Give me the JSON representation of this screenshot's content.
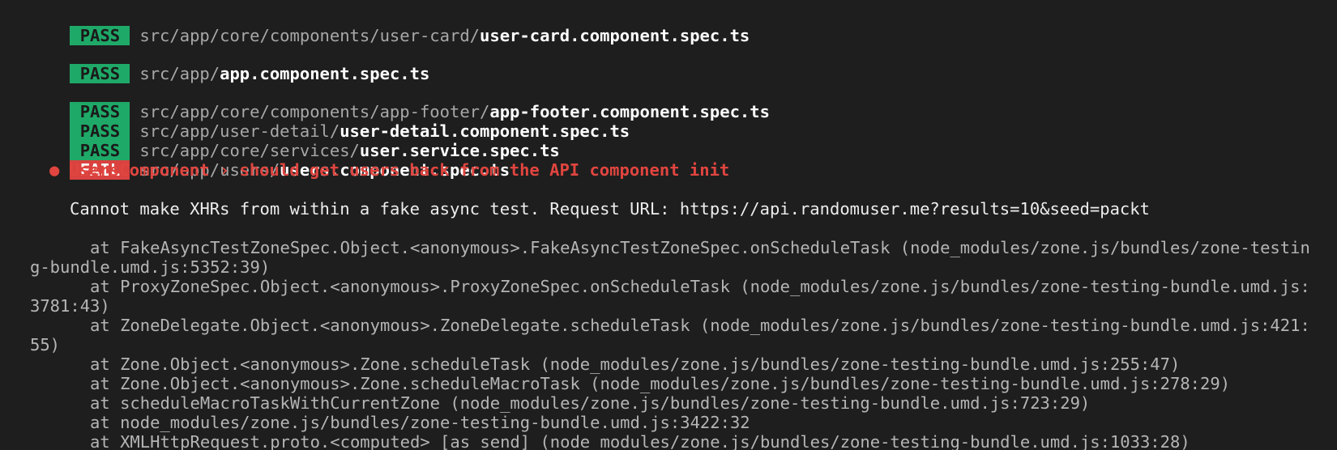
{
  "results": [
    {
      "status": "PASS",
      "dir": "src/app/core/components/user-card/",
      "file": "user-card.component.spec.ts"
    },
    {
      "status": "PASS",
      "dir": "src/app/",
      "file": "app.component.spec.ts"
    },
    {
      "status": "PASS",
      "dir": "src/app/core/components/app-footer/",
      "file": "app-footer.component.spec.ts"
    },
    {
      "status": "PASS",
      "dir": "src/app/user-detail/",
      "file": "user-detail.component.spec.ts"
    },
    {
      "status": "PASS",
      "dir": "src/app/core/services/",
      "file": "user.service.spec.ts"
    },
    {
      "status": "FAIL",
      "dir": "src/app/users/",
      "file": "users.component.spec.ts"
    }
  ],
  "error": {
    "title": "● UsersComponent › should get users back from the API component init",
    "message": "Cannot make XHRs from within a fake async test. Request URL: https://api.randomuser.me?results=10&seed=packt",
    "stack": [
      "      at FakeAsyncTestZoneSpec.Object.<anonymous>.FakeAsyncTestZoneSpec.onScheduleTask (node_modules/zone.js/bundles/zone-testin",
      "g-bundle.umd.js:5352:39)",
      "      at ProxyZoneSpec.Object.<anonymous>.ProxyZoneSpec.onScheduleTask (node_modules/zone.js/bundles/zone-testing-bundle.umd.js:",
      "3781:43)",
      "      at ZoneDelegate.Object.<anonymous>.ZoneDelegate.scheduleTask (node_modules/zone.js/bundles/zone-testing-bundle.umd.js:421:",
      "55)",
      "      at Zone.Object.<anonymous>.Zone.scheduleTask (node_modules/zone.js/bundles/zone-testing-bundle.umd.js:255:47)",
      "      at Zone.Object.<anonymous>.Zone.scheduleMacroTask (node_modules/zone.js/bundles/zone-testing-bundle.umd.js:278:29)",
      "      at scheduleMacroTaskWithCurrentZone (node_modules/zone.js/bundles/zone-testing-bundle.umd.js:723:29)",
      "      at node_modules/zone.js/bundles/zone-testing-bundle.umd.js:3422:32",
      "      at XMLHttpRequest.proto.<computed> [as send] (node_modules/zone.js/bundles/zone-testing-bundle.umd.js:1033:28)"
    ]
  },
  "colors": {
    "pass": "#1fa968",
    "fail": "#d9423f",
    "error_text": "#e0453f",
    "background": "#1e1e1e"
  }
}
